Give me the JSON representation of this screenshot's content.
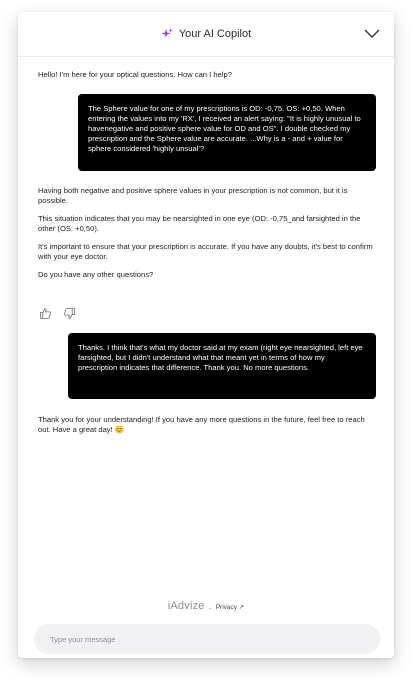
{
  "header": {
    "title": "Your AI Copilot",
    "icon": "sparkle-icon",
    "collapse_icon": "chevron-down-icon",
    "accent_color": "#8b3dff"
  },
  "messages": {
    "greeting": "Hello! I'm here for your optical questions. How can I help?",
    "user1": "The Sphere value for one of my prescriptions is OD: -0,75. OS: +0,50. When entering the values into my 'RX', I received an alert saying: \"It is highly unusual to havenegative and positive sphere value for OD and OS\". I double checked my prescription and the Sphere value are accurate. ...Why is a - and + value for sphere considered 'highly unsual'?",
    "bot1_p1": "Having both negative and positive sphere values in your prescription is not common, but it is possible.",
    "bot1_p2": "This situation indicates that you may be nearsighted in one eye (OD: -0,75_and farsighted in the other (OS: +0,50).",
    "bot1_p3": "It's important to ensure that your prescription is accurate. If you have any doubts, it's best to confirm with your eye doctor.",
    "bot1_p4": "Do you have any other questions?",
    "user2": "Thanks. I think that's what my doctor said at my exam (right eye nearsighted, left eye farsighted, but I didn't understand what that meant yet in terms of how my prescription indicates that difference. Thank you. No more questions.",
    "bot2": "Thank you for your understanding! If you have any more questions in the future, feel free to reach out. Have a great day! 😊"
  },
  "feedback": {
    "like_icon": "thumbs-up-icon",
    "dislike_icon": "thumbs-down-icon"
  },
  "footer": {
    "brand": "iAdvize",
    "separator": ".",
    "privacy": "Privacy ↗"
  },
  "composer": {
    "placeholder": "Type your message"
  }
}
